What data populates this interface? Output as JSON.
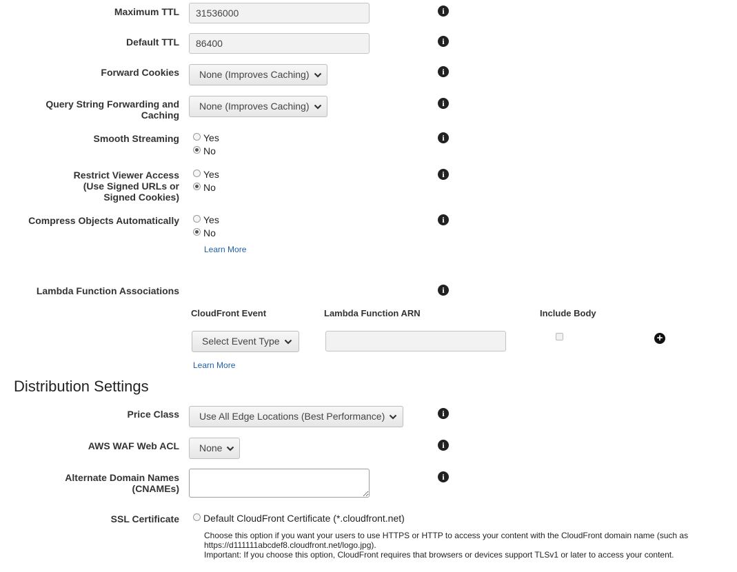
{
  "fields": {
    "max_ttl": {
      "label": "Maximum TTL",
      "value": "31536000"
    },
    "default_ttl": {
      "label": "Default TTL",
      "value": "86400"
    },
    "forward_cookies": {
      "label": "Forward Cookies",
      "selected": "None (Improves Caching)"
    },
    "query_string": {
      "label_line1": "Query String Forwarding and",
      "label_line2": "Caching",
      "selected": "None (Improves Caching)"
    },
    "smooth_streaming": {
      "label": "Smooth Streaming",
      "yes": "Yes",
      "no": "No",
      "checked": "No"
    },
    "restrict_viewer": {
      "label_line1": "Restrict Viewer Access",
      "label_line2": "(Use Signed URLs or",
      "label_line3": "Signed Cookies)",
      "yes": "Yes",
      "no": "No",
      "checked": "No"
    },
    "compress": {
      "label": "Compress Objects Automatically",
      "yes": "Yes",
      "no": "No",
      "checked": "No",
      "learn_more": "Learn More"
    }
  },
  "lambda": {
    "label": "Lambda Function Associations",
    "col_event": "CloudFront Event",
    "col_arn": "Lambda Function ARN",
    "col_body": "Include Body",
    "event_select": "Select Event Type",
    "arn_value": "",
    "include_body": false,
    "learn_more": "Learn More"
  },
  "distribution": {
    "heading": "Distribution Settings",
    "price_class": {
      "label": "Price Class",
      "selected": "Use All Edge Locations (Best Performance)"
    },
    "waf": {
      "label": "AWS WAF Web ACL",
      "selected": "None"
    },
    "cnames": {
      "label_line1": "Alternate Domain Names",
      "label_line2": "(CNAMEs)",
      "value": ""
    },
    "ssl": {
      "label": "SSL Certificate",
      "option": "Default CloudFront Certificate (*.cloudfront.net)",
      "desc_line1": "Choose this option if you want your users to use HTTPS or HTTP to access your content with the CloudFront domain name (such as",
      "desc_line2": "https://d111111abcdef8.cloudfront.net/logo.jpg).",
      "desc_line3": "Important: If you choose this option, CloudFront requires that browsers or devices support TLSv1 or later to access your content."
    }
  },
  "icons": {
    "info": "info-icon",
    "chevron": "chevron-down-icon",
    "add": "plus-circle-icon"
  },
  "colors": {
    "link": "#1f5fa8",
    "icon": "#222222"
  }
}
